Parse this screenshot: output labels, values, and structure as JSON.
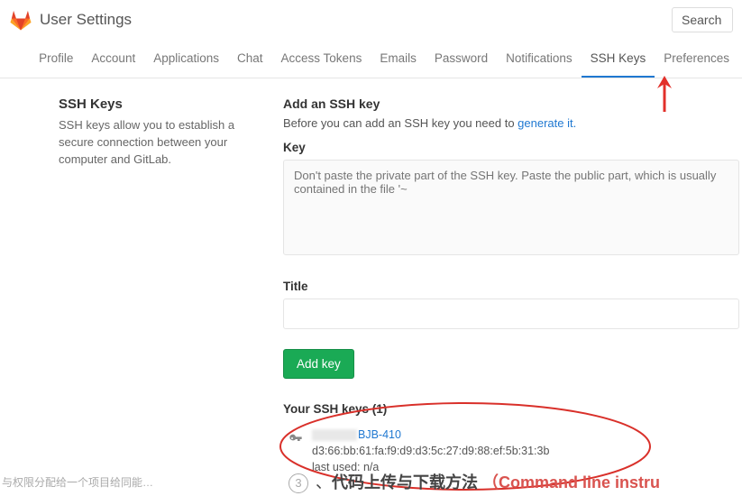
{
  "header": {
    "title": "User Settings",
    "search_label": "Search"
  },
  "tabs": {
    "items": [
      "Profile",
      "Account",
      "Applications",
      "Chat",
      "Access Tokens",
      "Emails",
      "Password",
      "Notifications",
      "SSH Keys",
      "Preferences"
    ],
    "active": "SSH Keys"
  },
  "sidebar": {
    "heading": "SSH Keys",
    "description": "SSH keys allow you to establish a secure connection between your computer and GitLab."
  },
  "form": {
    "heading": "Add an SSH key",
    "intro_prefix": "Before you can add an SSH key you need to ",
    "intro_link": "generate it.",
    "key_label": "Key",
    "key_placeholder": "Don't paste the private part of the SSH key. Paste the public part, which is usually contained in the file '~",
    "title_label": "Title",
    "add_button": "Add key"
  },
  "keys_list": {
    "heading": "Your SSH keys (1)",
    "items": [
      {
        "name_suffix": "BJB-410",
        "fingerprint": "d3:66:bb:61:fa:f9:d9:d3:5c:27:d9:88:ef:5b:31:3b",
        "last_used_label": "last used: n/a"
      }
    ]
  },
  "footer": {
    "cn_fragment": "与权限分配给一个项目给同能…",
    "step_num": "3",
    "step_cn": "代码上传与下载方法",
    "step_en": "（Command line instru"
  }
}
